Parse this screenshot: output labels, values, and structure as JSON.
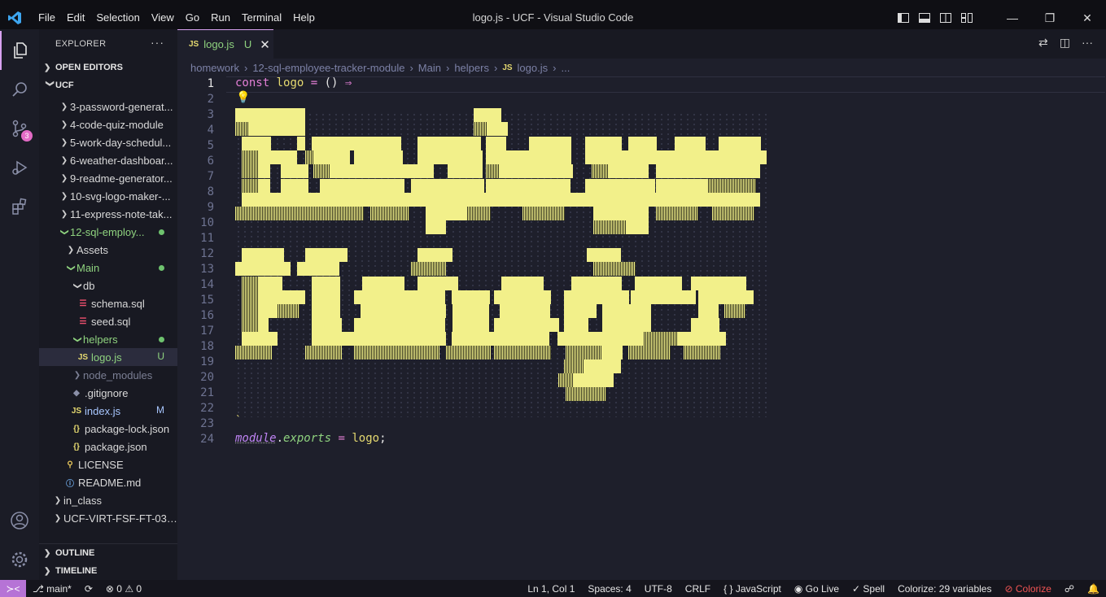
{
  "window": {
    "title": "logo.js - UCF - Visual Studio Code",
    "menu": [
      "File",
      "Edit",
      "Selection",
      "View",
      "Go",
      "Run",
      "Terminal",
      "Help"
    ]
  },
  "activity": {
    "source_control_badge": "3"
  },
  "sidebar": {
    "header": "EXPLORER",
    "open_editors": "OPEN EDITORS",
    "workspace": "UCF",
    "items": [
      {
        "label": "3-password-generat..."
      },
      {
        "label": "4-code-quiz-module"
      },
      {
        "label": "5-work-day-schedul..."
      },
      {
        "label": "6-weather-dashboar..."
      },
      {
        "label": "9-readme-generator..."
      },
      {
        "label": "10-svg-logo-maker-..."
      },
      {
        "label": "11-express-note-tak..."
      },
      {
        "label": "12-sql-employ..."
      },
      {
        "label": "Assets"
      },
      {
        "label": "Main"
      },
      {
        "label": "db"
      },
      {
        "label": "schema.sql"
      },
      {
        "label": "seed.sql"
      },
      {
        "label": "helpers"
      },
      {
        "label": "logo.js",
        "status": "U"
      },
      {
        "label": "node_modules"
      },
      {
        "label": ".gitignore"
      },
      {
        "label": "index.js",
        "status": "M"
      },
      {
        "label": "package-lock.json"
      },
      {
        "label": "package.json"
      },
      {
        "label": "LICENSE"
      },
      {
        "label": "README.md"
      },
      {
        "label": "in_class"
      },
      {
        "label": "UCF-VIRT-FSF-FT-03-..."
      }
    ],
    "outline": "OUTLINE",
    "timeline": "TIMELINE"
  },
  "editor": {
    "tab": {
      "label": "logo.js",
      "status": "U"
    },
    "breadcrumb": [
      "homework",
      "12-sql-employee-tracker-module",
      "Main",
      "helpers",
      "logo.js",
      "..."
    ],
    "line_numbers": [
      "1",
      "2",
      "3",
      "4",
      "5",
      "6",
      "7",
      "8",
      "9",
      "10",
      "11",
      "12",
      "13",
      "14",
      "15",
      "16",
      "17",
      "18",
      "19",
      "20",
      "21",
      "22",
      "23",
      "24"
    ],
    "line1": {
      "kw": "const",
      "name": "logo",
      "eq": "=",
      "parens": "()",
      "arrow": "⇒"
    },
    "line23": "`",
    "line24": {
      "module": "module",
      "dot": ".",
      "exports": "exports",
      "eq": "=",
      "name": "logo",
      "semi": ";"
    }
  },
  "statusbar": {
    "branch": "main*",
    "problems": "⊗ 0 ⚠ 0",
    "position": "Ln 1, Col 1",
    "spaces": "Spaces: 4",
    "encoding": "UTF-8",
    "eol": "CRLF",
    "language": "JavaScript",
    "golive": "Go Live",
    "spell": "Spell",
    "colorize_vars": "Colorize: 29 variables",
    "colorize": "Colorize"
  }
}
